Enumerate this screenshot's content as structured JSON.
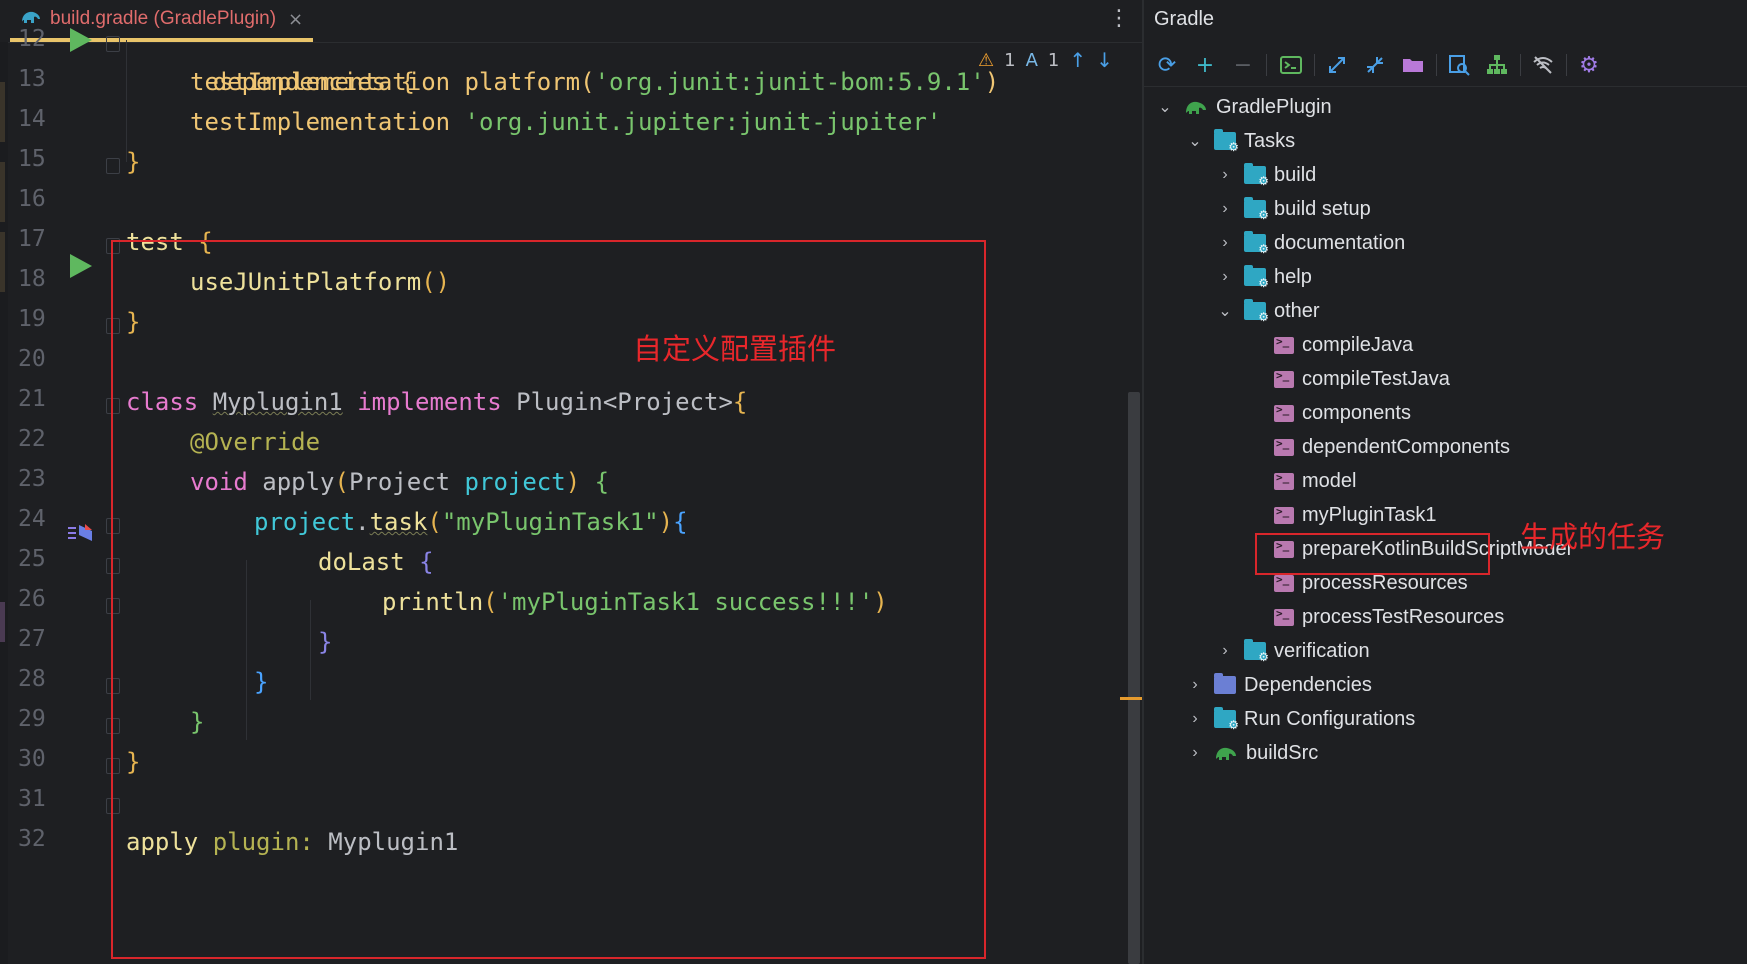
{
  "editor": {
    "tab": {
      "label": "build.gradle (GradlePlugin)",
      "close": "×"
    },
    "more_icon": "⋮",
    "inspections": {
      "warnings": "1",
      "typos": "1"
    },
    "lines": [
      {
        "n": "12"
      },
      {
        "n": "13"
      },
      {
        "n": "14"
      },
      {
        "n": "15"
      },
      {
        "n": "16"
      },
      {
        "n": "17"
      },
      {
        "n": "18"
      },
      {
        "n": "19"
      },
      {
        "n": "20"
      },
      {
        "n": "21"
      },
      {
        "n": "22"
      },
      {
        "n": "23"
      },
      {
        "n": "24"
      },
      {
        "n": "25"
      },
      {
        "n": "26"
      },
      {
        "n": "27"
      },
      {
        "n": "28"
      },
      {
        "n": "29"
      },
      {
        "n": "30"
      },
      {
        "n": "31"
      },
      {
        "n": "32"
      }
    ],
    "code": {
      "l12": "dependencies {",
      "l13a": "testImplementation platform(",
      "l13b": "'org.junit:junit-bom:5.9.1'",
      "l13c": ")",
      "l14a": "testImplementation ",
      "l14b": "'org.junit.jupiter:junit-jupiter'",
      "l15": "}",
      "l17a": "test ",
      "l17b": "{",
      "l18a": "useJUnitPlatform",
      "l18b": "()",
      "l19": "}",
      "l21a": "class ",
      "l21b": "Myplugin1",
      "l21c": " implements ",
      "l21d": "Plugin",
      "l21e": "<Project>",
      "l21f": "{",
      "l22": "@Override",
      "l23a": "void ",
      "l23b": "apply",
      "l23c": "(",
      "l23d": "Project ",
      "l23e": "project",
      "l23f": ") ",
      "l23g": "{",
      "l24a": "project",
      "l24b": ".",
      "l24c": "task",
      "l24d": "(",
      "l24e": "\"myPluginTask1\"",
      "l24f": ")",
      "l24g": "{",
      "l25a": "doLast ",
      "l25b": "{",
      "l26a": "println",
      "l26b": "(",
      "l26c": "'myPluginTask1 success!!!'",
      "l26d": ")",
      "l27": "}",
      "l28": "}",
      "l29": "}",
      "l30": "}",
      "l32a": "apply ",
      "l32b": "plugin: ",
      "l32c": "Myplugin1"
    },
    "annotation": "自定义配置插件"
  },
  "gradle": {
    "title": "Gradle",
    "toolbar": [
      "refresh-icon",
      "add-icon",
      "remove-icon",
      "terminal-icon",
      "expand-all-icon",
      "collapse-all-icon",
      "project-folder-icon",
      "analyze-icon",
      "dependencies-tree-icon",
      "offline-mode-icon",
      "settings-icon"
    ],
    "tree": {
      "root": "GradlePlugin",
      "tasks": "Tasks",
      "groups": [
        "build",
        "build setup",
        "documentation",
        "help"
      ],
      "other": "other",
      "other_tasks": [
        "compileJava",
        "compileTestJava",
        "components",
        "dependentComponents",
        "model",
        "myPluginTask1",
        "prepareKotlinBuildScriptModel",
        "processResources",
        "processTestResources"
      ],
      "verification": "verification",
      "dependencies": "Dependencies",
      "run_configurations": "Run Configurations",
      "buildsrc": "buildSrc"
    },
    "annotation": "生成的任务"
  },
  "colors": {
    "accent_red": "#d9262b",
    "tab_underline": "#e9c46a",
    "run_green": "#5fb85f"
  }
}
